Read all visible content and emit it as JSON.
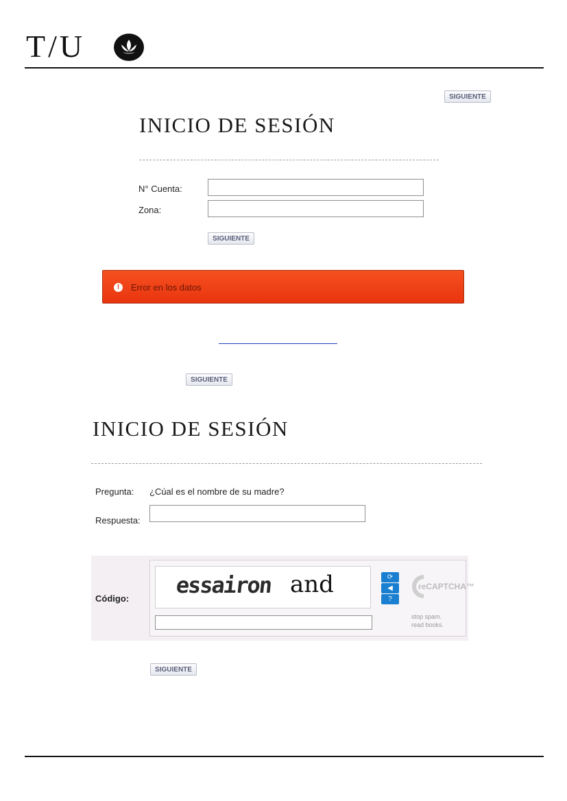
{
  "header": {
    "logo_text": "T/U"
  },
  "top_button": {
    "label": "SIGUIENTE"
  },
  "section1": {
    "title": "INICIO DE SESIÓN",
    "account_label": "N° Cuenta:",
    "zone_label": "Zona:",
    "account_value": "",
    "zone_value": "",
    "button_label": "SIGUIENTE"
  },
  "error": {
    "icon": "!",
    "message": "Error en los datos"
  },
  "link": {
    "text": ""
  },
  "middle_button": {
    "label": "SIGUIENTE"
  },
  "section2": {
    "title": "INICIO DE SESIÓN",
    "question_label": "Pregunta:",
    "question_text": "¿Cúal es el nombre de su madre?",
    "answer_label": "Respuesta:",
    "answer_value": ""
  },
  "captcha": {
    "label": "Código:",
    "word1": "essairon",
    "word2": "and",
    "input_value": "",
    "logo_text": "reCAPTCHA™",
    "tagline_1": "stop spam.",
    "tagline_2": "read books.",
    "icons": [
      "refresh-icon",
      "audio-icon",
      "help-icon"
    ]
  },
  "bottom_button": {
    "label": "SIGUIENTE"
  },
  "colors": {
    "error_bg": "#f0441a",
    "captcha_btn": "#1a7fd0",
    "link": "#1f3fbf"
  }
}
